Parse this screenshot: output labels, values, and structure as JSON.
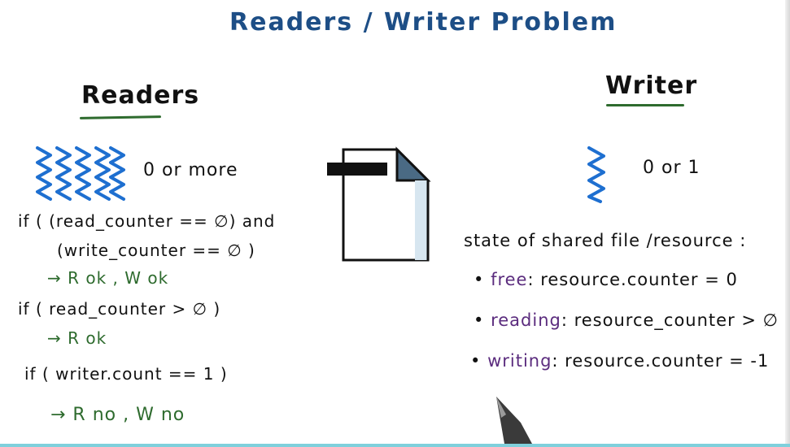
{
  "title": "Readers / Writer Problem",
  "readers": {
    "heading": "Readers",
    "count_label": "0 or more",
    "cond1_line1": "if ( (read_counter == ∅) and",
    "cond1_line2": "(write_counter == ∅ )",
    "cond1_result": "→ R ok , W ok",
    "cond2_line1": "if  ( read_counter > ∅ )",
    "cond2_result": "→ R ok",
    "cond3_line1": "if  ( writer.count == 1 )",
    "cond3_result": "→ R no , W no"
  },
  "writer": {
    "heading": "Writer",
    "count_label": "0 or 1"
  },
  "state": {
    "heading": "state of shared file /resource :",
    "free_label": "free",
    "free_rule": ": resource.counter = 0",
    "reading_label": "reading",
    "reading_rule": ": resource_counter > ∅",
    "writing_label": "writing",
    "writing_rule": ": resource.counter = -1"
  },
  "colors": {
    "title": "#1d4e86",
    "squiggle": "#1e6fd0",
    "arrow_green": "#2e6b2e",
    "state_purple": "#5b2c7e",
    "document_fill": "#ffffff",
    "document_fold": "#4a6a84"
  },
  "icons": {
    "reader_threads": "squiggle-icon",
    "writer_thread": "squiggle-icon",
    "shared_file": "document-icon",
    "pen": "stylus-icon"
  }
}
